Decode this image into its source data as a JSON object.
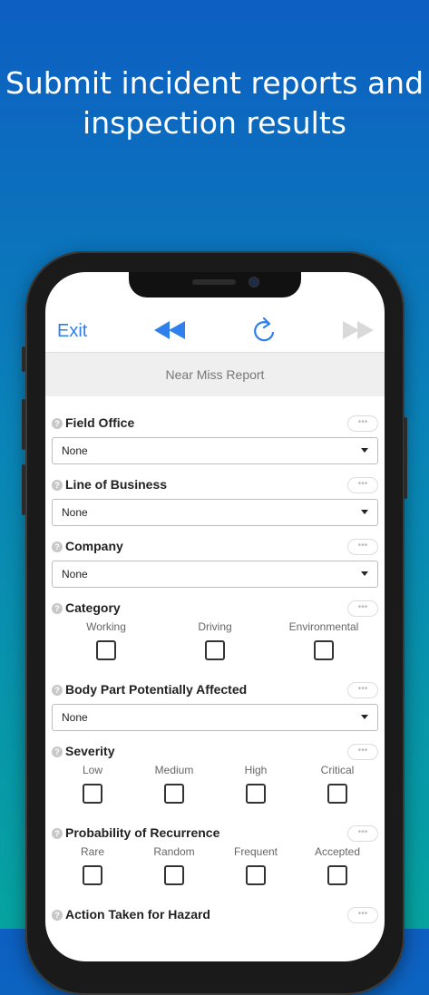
{
  "headline": {
    "line1": "Submit incident reports and",
    "line2": "inspection results"
  },
  "nav": {
    "exit": "Exit",
    "back_icon": "rewind-icon",
    "refresh_icon": "refresh-icon",
    "forward_icon": "fast-forward-icon"
  },
  "form_title": "Near Miss Report",
  "more_label": "•••",
  "help_label": "?",
  "fields": {
    "field_office": {
      "label": "Field Office",
      "value": "None"
    },
    "line_of_business": {
      "label": "Line of Business",
      "value": "None"
    },
    "company": {
      "label": "Company",
      "value": "None"
    },
    "category": {
      "label": "Category",
      "options": [
        "Working",
        "Driving",
        "Environmental"
      ]
    },
    "body_part": {
      "label": "Body Part Potentially Affected",
      "value": "None"
    },
    "severity": {
      "label": "Severity",
      "options": [
        "Low",
        "Medium",
        "High",
        "Critical"
      ]
    },
    "probability": {
      "label": "Probability of Recurrence",
      "options": [
        "Rare",
        "Random",
        "Frequent",
        "Accepted"
      ]
    },
    "action": {
      "label": "Action Taken for Hazard"
    }
  },
  "colors": {
    "accent": "#2f80ed",
    "disabled": "#d9d9d9"
  }
}
